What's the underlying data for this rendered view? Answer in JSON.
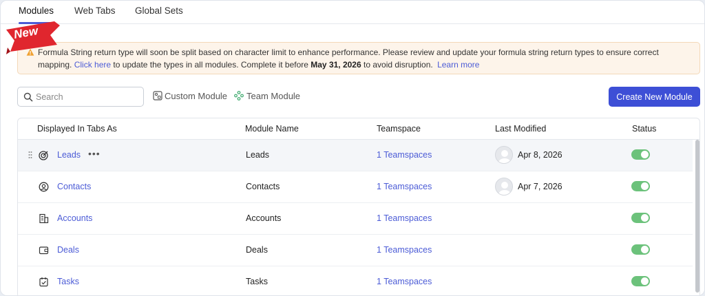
{
  "tabs": [
    {
      "label": "Modules"
    },
    {
      "label": "Web Tabs"
    },
    {
      "label": "Global Sets"
    }
  ],
  "badge": {
    "label": "New",
    "color": "#e0262e"
  },
  "alert": {
    "text_before": "Formula String return type will soon be split based on character limit to enhance performance. Please review and update your formula string return types to ensure correct mapping.",
    "click_here": "Click here",
    "text_mid": "to update the types in all modules. Complete it before",
    "deadline": "May 31, 2026",
    "text_after": "to avoid disruption.",
    "learn_more": "Learn more",
    "icon": "warning-icon",
    "icon_color": "#f0a030"
  },
  "toolbar": {
    "search_placeholder": "Search",
    "custom_module": "Custom Module",
    "team_module": "Team Module",
    "create_button": "Create New Module",
    "accent": "#3d4fd6"
  },
  "table": {
    "headers": {
      "displayed": "Displayed In Tabs As",
      "module_name": "Module Name",
      "teamspace": "Teamspace",
      "last_modified": "Last Modified",
      "status": "Status"
    },
    "rows": [
      {
        "tab_label": "Leads",
        "icon": "target-icon",
        "module_name": "Leads",
        "teamspace": "1 Teamspaces",
        "last_modified": "Apr 8, 2026",
        "status_on": true,
        "more": "•••"
      },
      {
        "tab_label": "Contacts",
        "icon": "contact-icon",
        "module_name": "Contacts",
        "teamspace": "1 Teamspaces",
        "last_modified": "Apr 7, 2026",
        "status_on": true
      },
      {
        "tab_label": "Accounts",
        "icon": "building-icon",
        "module_name": "Accounts",
        "teamspace": "1 Teamspaces",
        "last_modified": "",
        "status_on": true
      },
      {
        "tab_label": "Deals",
        "icon": "wallet-icon",
        "module_name": "Deals",
        "teamspace": "1 Teamspaces",
        "last_modified": "",
        "status_on": true
      },
      {
        "tab_label": "Tasks",
        "icon": "task-icon",
        "module_name": "Tasks",
        "teamspace": "1 Teamspaces",
        "last_modified": "",
        "status_on": true
      }
    ],
    "toggle_color": "#6cc27b"
  }
}
